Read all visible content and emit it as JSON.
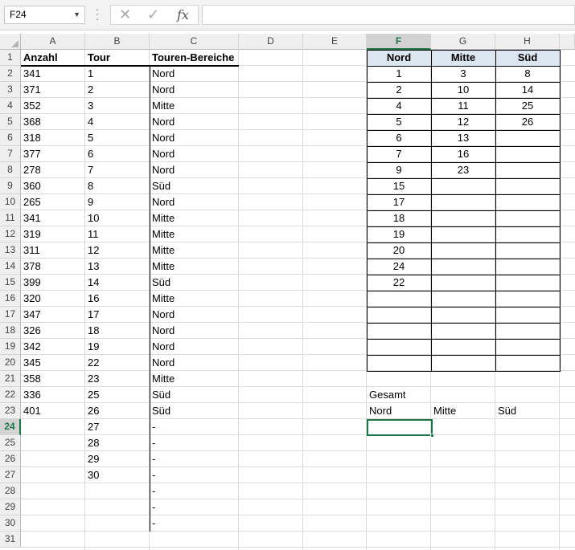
{
  "formula_bar": {
    "name_box": "F24",
    "formula": ""
  },
  "columns": [
    "A",
    "B",
    "C",
    "D",
    "E",
    "F",
    "G",
    "H"
  ],
  "selected_column": "F",
  "selected_row": "24",
  "rows": [
    "1",
    "2",
    "3",
    "4",
    "5",
    "6",
    "7",
    "8",
    "9",
    "10",
    "11",
    "12",
    "13",
    "14",
    "15",
    "16",
    "17",
    "18",
    "19",
    "20",
    "21",
    "22",
    "23",
    "24",
    "25",
    "26",
    "27",
    "28",
    "29",
    "30",
    "31"
  ],
  "table_left": {
    "headers": {
      "a": "Anzahl",
      "b": "Tour",
      "c": "Touren-Bereiche"
    },
    "rows": [
      {
        "a": "341",
        "b": "1",
        "c": "Nord"
      },
      {
        "a": "371",
        "b": "2",
        "c": "Nord"
      },
      {
        "a": "352",
        "b": "3",
        "c": "Mitte"
      },
      {
        "a": "368",
        "b": "4",
        "c": "Nord"
      },
      {
        "a": "318",
        "b": "5",
        "c": "Nord"
      },
      {
        "a": "377",
        "b": "6",
        "c": "Nord"
      },
      {
        "a": "278",
        "b": "7",
        "c": "Nord"
      },
      {
        "a": "360",
        "b": "8",
        "c": "Süd"
      },
      {
        "a": "265",
        "b": "9",
        "c": "Nord"
      },
      {
        "a": "341",
        "b": "10",
        "c": "Mitte"
      },
      {
        "a": "319",
        "b": "11",
        "c": "Mitte"
      },
      {
        "a": "311",
        "b": "12",
        "c": "Mitte"
      },
      {
        "a": "378",
        "b": "13",
        "c": "Mitte"
      },
      {
        "a": "399",
        "b": "14",
        "c": "Süd"
      },
      {
        "a": "320",
        "b": "16",
        "c": "Mitte"
      },
      {
        "a": "347",
        "b": "17",
        "c": "Nord"
      },
      {
        "a": "326",
        "b": "18",
        "c": "Nord"
      },
      {
        "a": "342",
        "b": "19",
        "c": "Nord"
      },
      {
        "a": "345",
        "b": "22",
        "c": "Nord"
      },
      {
        "a": "358",
        "b": "23",
        "c": "Mitte"
      },
      {
        "a": "336",
        "b": "25",
        "c": "Süd"
      },
      {
        "a": "401",
        "b": "26",
        "c": "Süd"
      },
      {
        "a": "",
        "b": "27",
        "c": "-"
      },
      {
        "a": "",
        "b": "28",
        "c": "-"
      },
      {
        "a": "",
        "b": "29",
        "c": "-"
      },
      {
        "a": "",
        "b": "30",
        "c": "-"
      },
      {
        "a": "",
        "b": "",
        "c": "-"
      },
      {
        "a": "",
        "b": "",
        "c": "-"
      },
      {
        "a": "",
        "b": "",
        "c": "-"
      }
    ]
  },
  "table_right": {
    "headers": {
      "f": "Nord",
      "g": "Mitte",
      "h": "Süd"
    },
    "rows": [
      {
        "f": "1",
        "g": "3",
        "h": "8"
      },
      {
        "f": "2",
        "g": "10",
        "h": "14"
      },
      {
        "f": "4",
        "g": "11",
        "h": "25"
      },
      {
        "f": "5",
        "g": "12",
        "h": "26"
      },
      {
        "f": "6",
        "g": "13",
        "h": ""
      },
      {
        "f": "7",
        "g": "16",
        "h": ""
      },
      {
        "f": "9",
        "g": "23",
        "h": ""
      },
      {
        "f": "15",
        "g": "",
        "h": ""
      },
      {
        "f": "17",
        "g": "",
        "h": ""
      },
      {
        "f": "18",
        "g": "",
        "h": ""
      },
      {
        "f": "19",
        "g": "",
        "h": ""
      },
      {
        "f": "20",
        "g": "",
        "h": ""
      },
      {
        "f": "24",
        "g": "",
        "h": ""
      },
      {
        "f": "22",
        "g": "",
        "h": ""
      },
      {
        "f": "",
        "g": "",
        "h": ""
      },
      {
        "f": "",
        "g": "",
        "h": ""
      },
      {
        "f": "",
        "g": "",
        "h": ""
      },
      {
        "f": "",
        "g": "",
        "h": ""
      },
      {
        "f": "",
        "g": "",
        "h": ""
      }
    ]
  },
  "summary": {
    "gesamt": "Gesamt",
    "nord": "Nord",
    "mitte": "Mitte",
    "sued": "Süd"
  },
  "colors": {
    "accent": "#217346",
    "table_header_bg": "#dce6f1"
  },
  "icons": {
    "cancel": "x-icon",
    "enter": "check-icon",
    "function": "fx-icon"
  }
}
